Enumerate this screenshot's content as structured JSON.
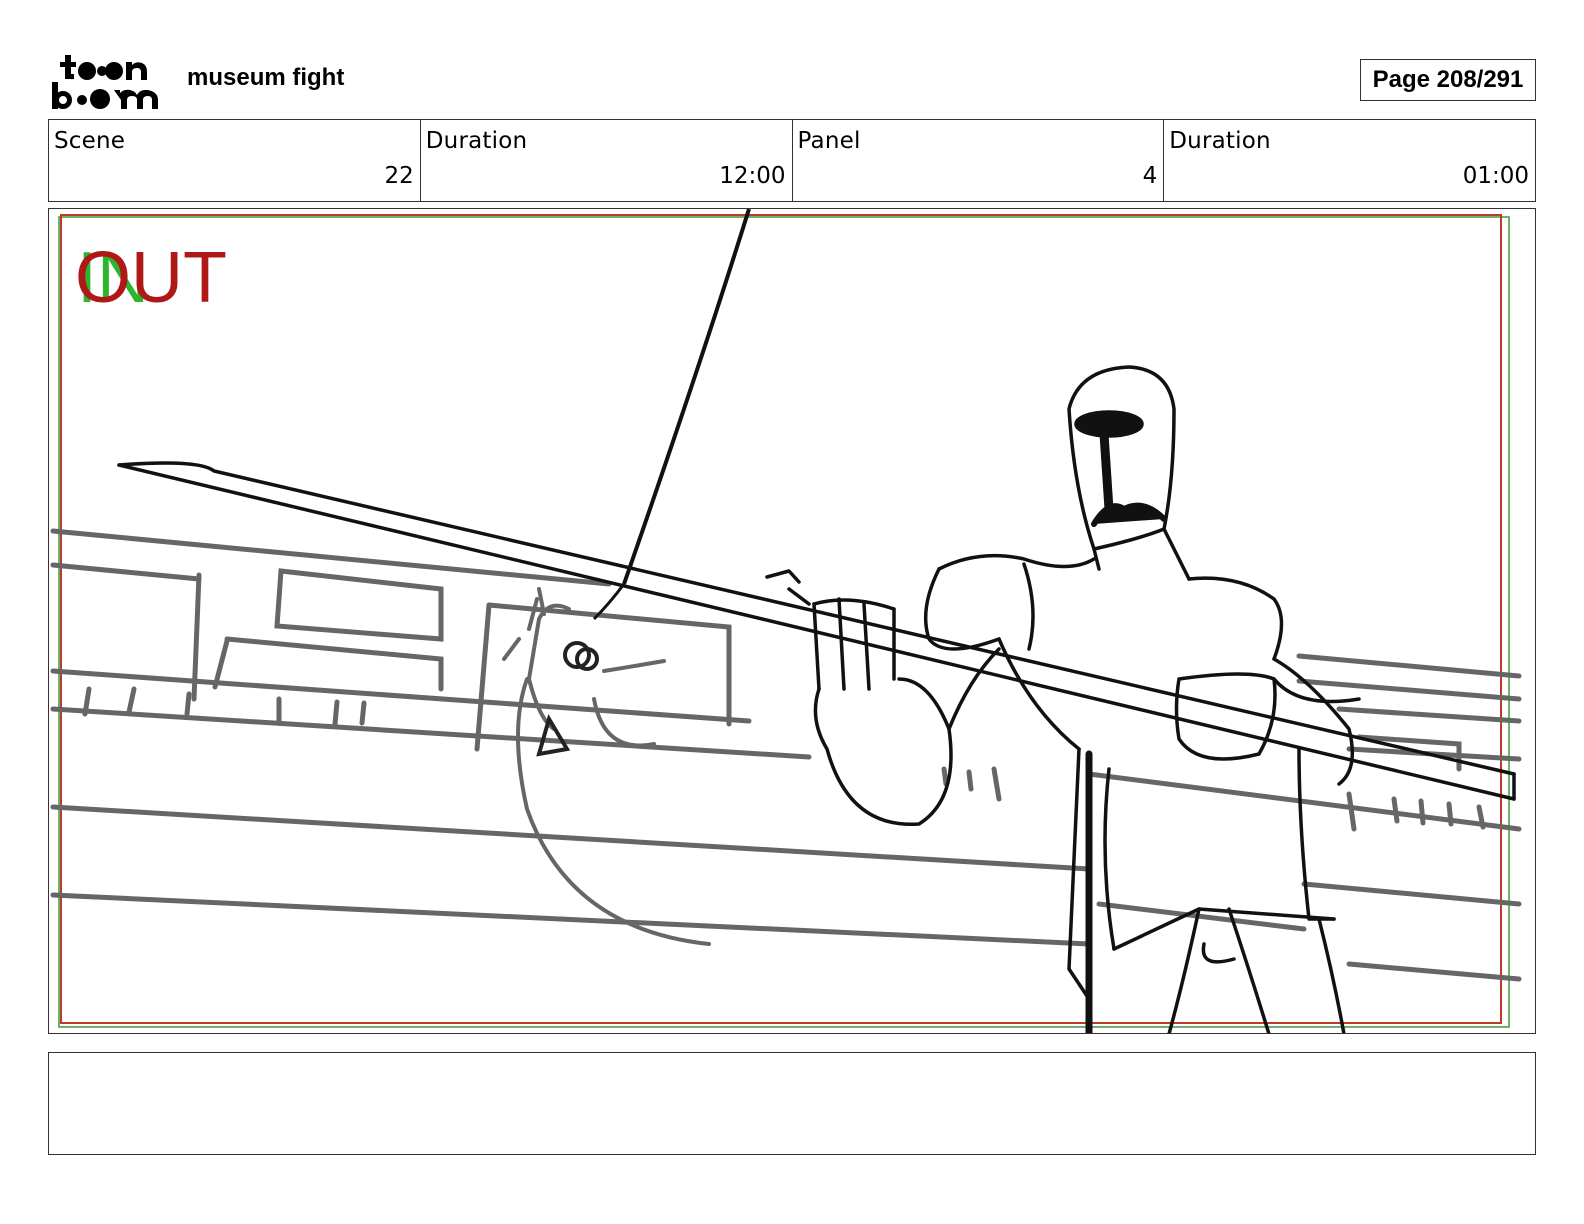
{
  "header": {
    "logo_text": "toon boom",
    "project_title": "museum fight",
    "page_label": "Page 208/291"
  },
  "info": {
    "scene_label": "Scene",
    "scene_value": "22",
    "scene_duration_label": "Duration",
    "scene_duration_value": "12:00",
    "panel_label": "Panel",
    "panel_value": "4",
    "panel_duration_label": "Duration",
    "panel_duration_value": "01:00"
  },
  "panel": {
    "in_marker": "IN",
    "out_marker": "OUT",
    "colors": {
      "in": "#2db52d",
      "out": "#b01818",
      "safe_frame_red": "#c0392b",
      "safe_frame_green": "#3a9a3a"
    }
  },
  "caption": {
    "text": ""
  }
}
